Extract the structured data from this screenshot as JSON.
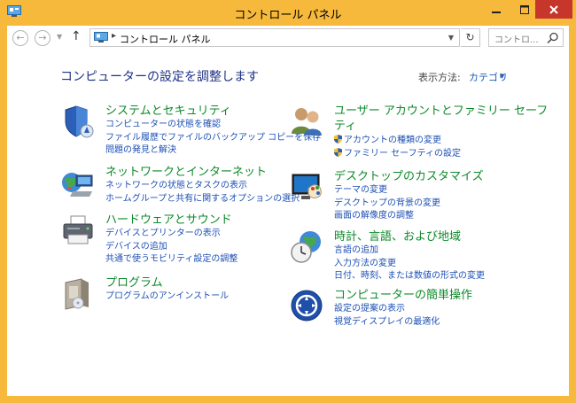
{
  "window": {
    "title": "コントロール パネル"
  },
  "nav": {
    "address": "コントロール パネル",
    "search_placeholder": "コントロ..."
  },
  "main": {
    "heading": "コンピューターの設定を調整します",
    "view_by_label": "表示方法:",
    "view_by_value": "カテゴリ"
  },
  "categories": [
    {
      "title": "システムとセキュリティ",
      "icon": "shield-icon",
      "links": [
        "コンピューターの状態を確認",
        "ファイル履歴でファイルのバックアップ コピーを保存",
        "問題の発見と解決"
      ]
    },
    {
      "title": "ネットワークとインターネット",
      "icon": "network-globe-icon",
      "links": [
        "ネットワークの状態とタスクの表示",
        "ホームグループと共有に関するオプションの選択"
      ]
    },
    {
      "title": "ハードウェアとサウンド",
      "icon": "printer-icon",
      "links": [
        "デバイスとプリンターの表示",
        "デバイスの追加",
        "共通で使うモビリティ設定の調整"
      ]
    },
    {
      "title": "プログラム",
      "icon": "program-box-icon",
      "links": [
        "プログラムのアンインストール"
      ]
    },
    {
      "title1": "ユーザー アカウントとファミリー セーフ",
      "title2": "ティ",
      "icon": "users-icon",
      "links": [
        "アカウントの種類の変更",
        "ファミリー セーフティの設定"
      ]
    },
    {
      "title": "デスクトップのカスタマイズ",
      "icon": "monitor-palette-icon",
      "links": [
        "テーマの変更",
        "デスクトップの背景の変更",
        "画面の解像度の調整"
      ]
    },
    {
      "title": "時計、言語、および地域",
      "icon": "clock-globe-icon",
      "links": [
        "言語の追加",
        "入力方法の変更",
        "日付、時刻、または数値の形式の変更"
      ]
    },
    {
      "title": "コンピューターの簡単操作",
      "icon": "ease-of-access-icon",
      "links": [
        "設定の提案の表示",
        "視覚ディスプレイの最適化"
      ]
    }
  ],
  "colors": {
    "frame": "#f6b93b",
    "category_title": "#0d8a2a",
    "link": "#1e50b4",
    "heading": "#1e3287",
    "close": "#c7362a"
  }
}
